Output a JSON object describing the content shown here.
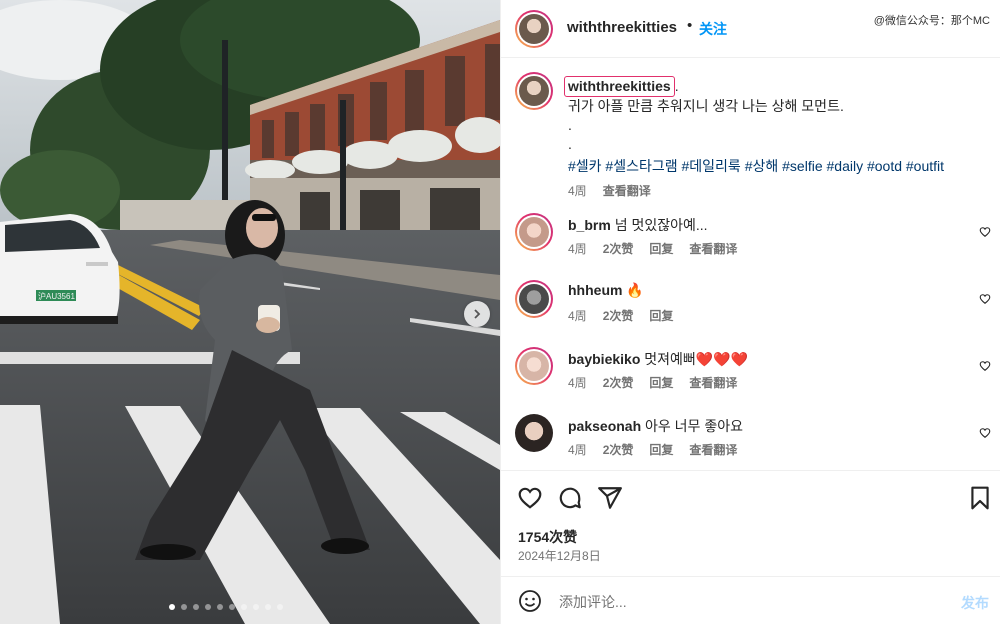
{
  "watermark": "@微信公众号：那个MC",
  "post": {
    "username": "withthreekitties",
    "separator": "•",
    "follow_label": "关注",
    "caption_period": ".",
    "caption_text": "귀가 아플 만큼 추워지니 생각 나는 상해 모먼트.",
    "caption_dot1": ".",
    "caption_dot2": ".",
    "hashtags": "#셀카 #셀스타그램 #데일리룩 #상해 #selfie #daily #ootd #outfit",
    "caption_time": "4周",
    "see_translation": "查看翻译",
    "likes": "1754次赞",
    "date": "2024年12月8日"
  },
  "media": {
    "plate": "沪AU3561",
    "slides_total": 10,
    "active_slide": 1
  },
  "comments": [
    {
      "user": "b_brm",
      "text": "넘 멋있잖아예...",
      "time": "4周",
      "likes": "2次赞",
      "reply": "回复",
      "translate": "查看翻译",
      "ring": true
    },
    {
      "user": "hhheum",
      "text": "🔥",
      "time": "4周",
      "likes": "2次赞",
      "reply": "回复",
      "translate": "",
      "ring": true
    },
    {
      "user": "baybiekiko",
      "text": "멋져예뻐❤️❤️❤️",
      "time": "4周",
      "likes": "2次赞",
      "reply": "回复",
      "translate": "查看翻译",
      "ring": true
    },
    {
      "user": "pakseonah",
      "text": "아우 너무 좋아요",
      "time": "4周",
      "likes": "2次赞",
      "reply": "回复",
      "translate": "查看翻译",
      "ring": false
    }
  ],
  "add_comment": {
    "placeholder": "添加评论...",
    "post_label": "发布"
  },
  "icons": [
    "heart-icon",
    "comment-icon",
    "share-icon",
    "bookmark-icon",
    "emoji-icon",
    "chevron-right-icon"
  ]
}
